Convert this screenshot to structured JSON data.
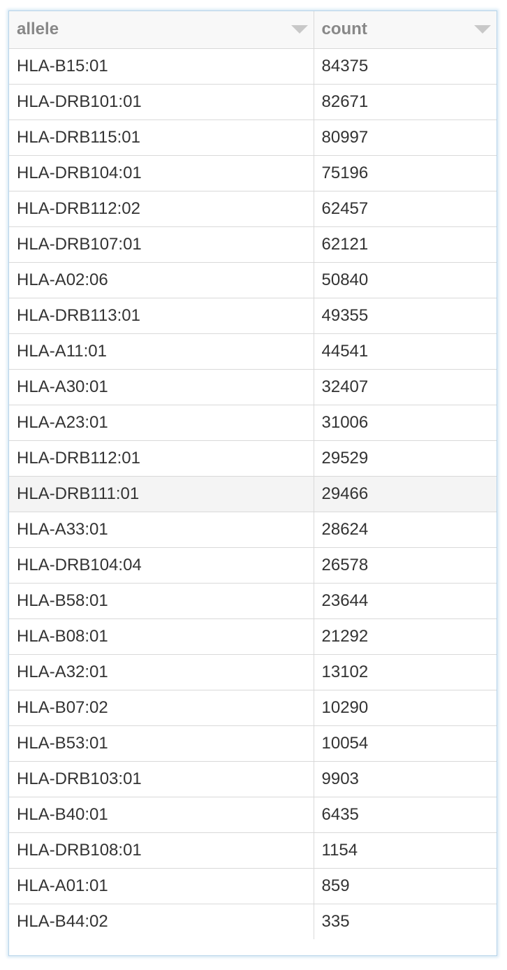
{
  "table": {
    "columns": [
      {
        "key": "allele",
        "label": "allele",
        "sort_icon": "triangle-down-icon"
      },
      {
        "key": "count",
        "label": "count",
        "sort_icon": "triangle-down-icon"
      }
    ],
    "hovered_row": 12,
    "rows": [
      {
        "allele": "HLA-B15:01",
        "count": "84375"
      },
      {
        "allele": "HLA-DRB101:01",
        "count": "82671"
      },
      {
        "allele": "HLA-DRB115:01",
        "count": "80997"
      },
      {
        "allele": "HLA-DRB104:01",
        "count": "75196"
      },
      {
        "allele": "HLA-DRB112:02",
        "count": "62457"
      },
      {
        "allele": "HLA-DRB107:01",
        "count": "62121"
      },
      {
        "allele": "HLA-A02:06",
        "count": "50840"
      },
      {
        "allele": "HLA-DRB113:01",
        "count": "49355"
      },
      {
        "allele": "HLA-A11:01",
        "count": "44541"
      },
      {
        "allele": "HLA-A30:01",
        "count": "32407"
      },
      {
        "allele": "HLA-A23:01",
        "count": "31006"
      },
      {
        "allele": "HLA-DRB112:01",
        "count": "29529"
      },
      {
        "allele": "HLA-DRB111:01",
        "count": "29466"
      },
      {
        "allele": "HLA-A33:01",
        "count": "28624"
      },
      {
        "allele": "HLA-DRB104:04",
        "count": "26578"
      },
      {
        "allele": "HLA-B58:01",
        "count": "23644"
      },
      {
        "allele": "HLA-B08:01",
        "count": "21292"
      },
      {
        "allele": "HLA-A32:01",
        "count": "13102"
      },
      {
        "allele": "HLA-B07:02",
        "count": "10290"
      },
      {
        "allele": "HLA-B53:01",
        "count": "10054"
      },
      {
        "allele": "HLA-DRB103:01",
        "count": "9903"
      },
      {
        "allele": "HLA-B40:01",
        "count": "6435"
      },
      {
        "allele": "HLA-DRB108:01",
        "count": "1154"
      },
      {
        "allele": "HLA-A01:01",
        "count": "859"
      },
      {
        "allele": "HLA-B44:02",
        "count": "335"
      }
    ]
  },
  "colors": {
    "frame_border": "#b6d3e8",
    "header_bg": "#f8f8f8",
    "header_text": "#888888",
    "cell_text": "#333333",
    "grid_line": "#d9d9d9",
    "hover_row_bg": "#f4f4f4",
    "sort_caret": "#c8c8c8"
  }
}
